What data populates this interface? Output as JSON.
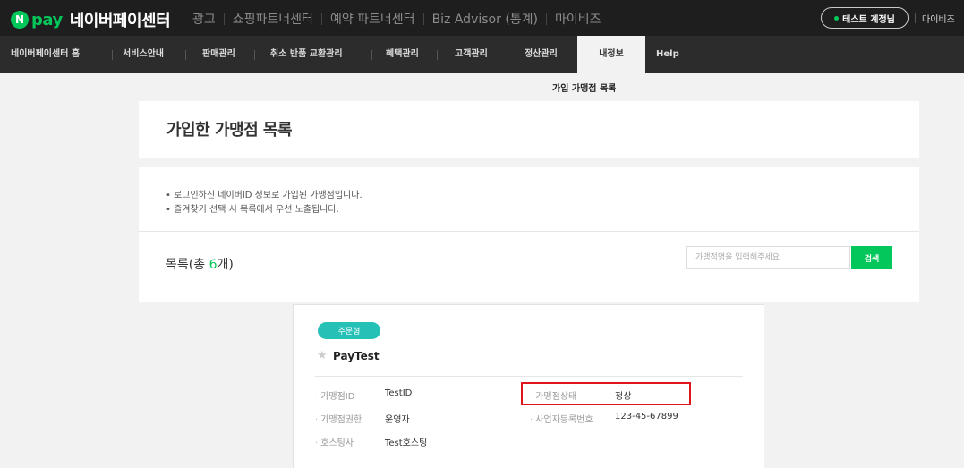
{
  "header": {
    "logo_n": "N",
    "logo_pay": "pay",
    "center_title": "네이버페이센터",
    "nav": [
      "광고",
      "쇼핑파트너센터",
      "예약 파트너센터",
      "Biz Advisor (통계)",
      "마이비즈"
    ],
    "account_button": "테스트 계정님",
    "mybiz": "마이비즈"
  },
  "menu": {
    "items": [
      "네이버페이센터 홈",
      "서비스안내",
      "판매관리",
      "취소 반품 교환관리",
      "혜택관리",
      "고객관리",
      "정산관리"
    ],
    "active": "내정보",
    "help": "Help",
    "submenu": "가입 가맹점 목록"
  },
  "page": {
    "title": "가입한 가맹점 목록",
    "notices": [
      "• 로그인하신 네이버ID 정보로 가입된 가맹점입니다.",
      "• 즐겨찾기 선택 시 목록에서 우선 노출됩니다."
    ],
    "list_title_prefix": "목록(총 ",
    "list_count": "6",
    "list_title_suffix": "개)",
    "search_placeholder": "가맹점명을 입력해주세요.",
    "search_button": "검색"
  },
  "card": {
    "badge": "주문형",
    "name": "PayTest",
    "fields": {
      "id_label": "가맹점ID",
      "id_value": "TestID",
      "status_label": "가맹점상태",
      "status_value": "정상",
      "role_label": "가맹점권한",
      "role_value": "운영자",
      "bizno_label": "사업자등록번호",
      "bizno_value": "123-45-67899",
      "hosting_label": "호스팅사",
      "hosting_value": "Test호스팅"
    }
  },
  "colors": {
    "brand_green": "#03c75a",
    "badge_teal": "#25c1b6",
    "highlight_red": "#e0161b"
  }
}
